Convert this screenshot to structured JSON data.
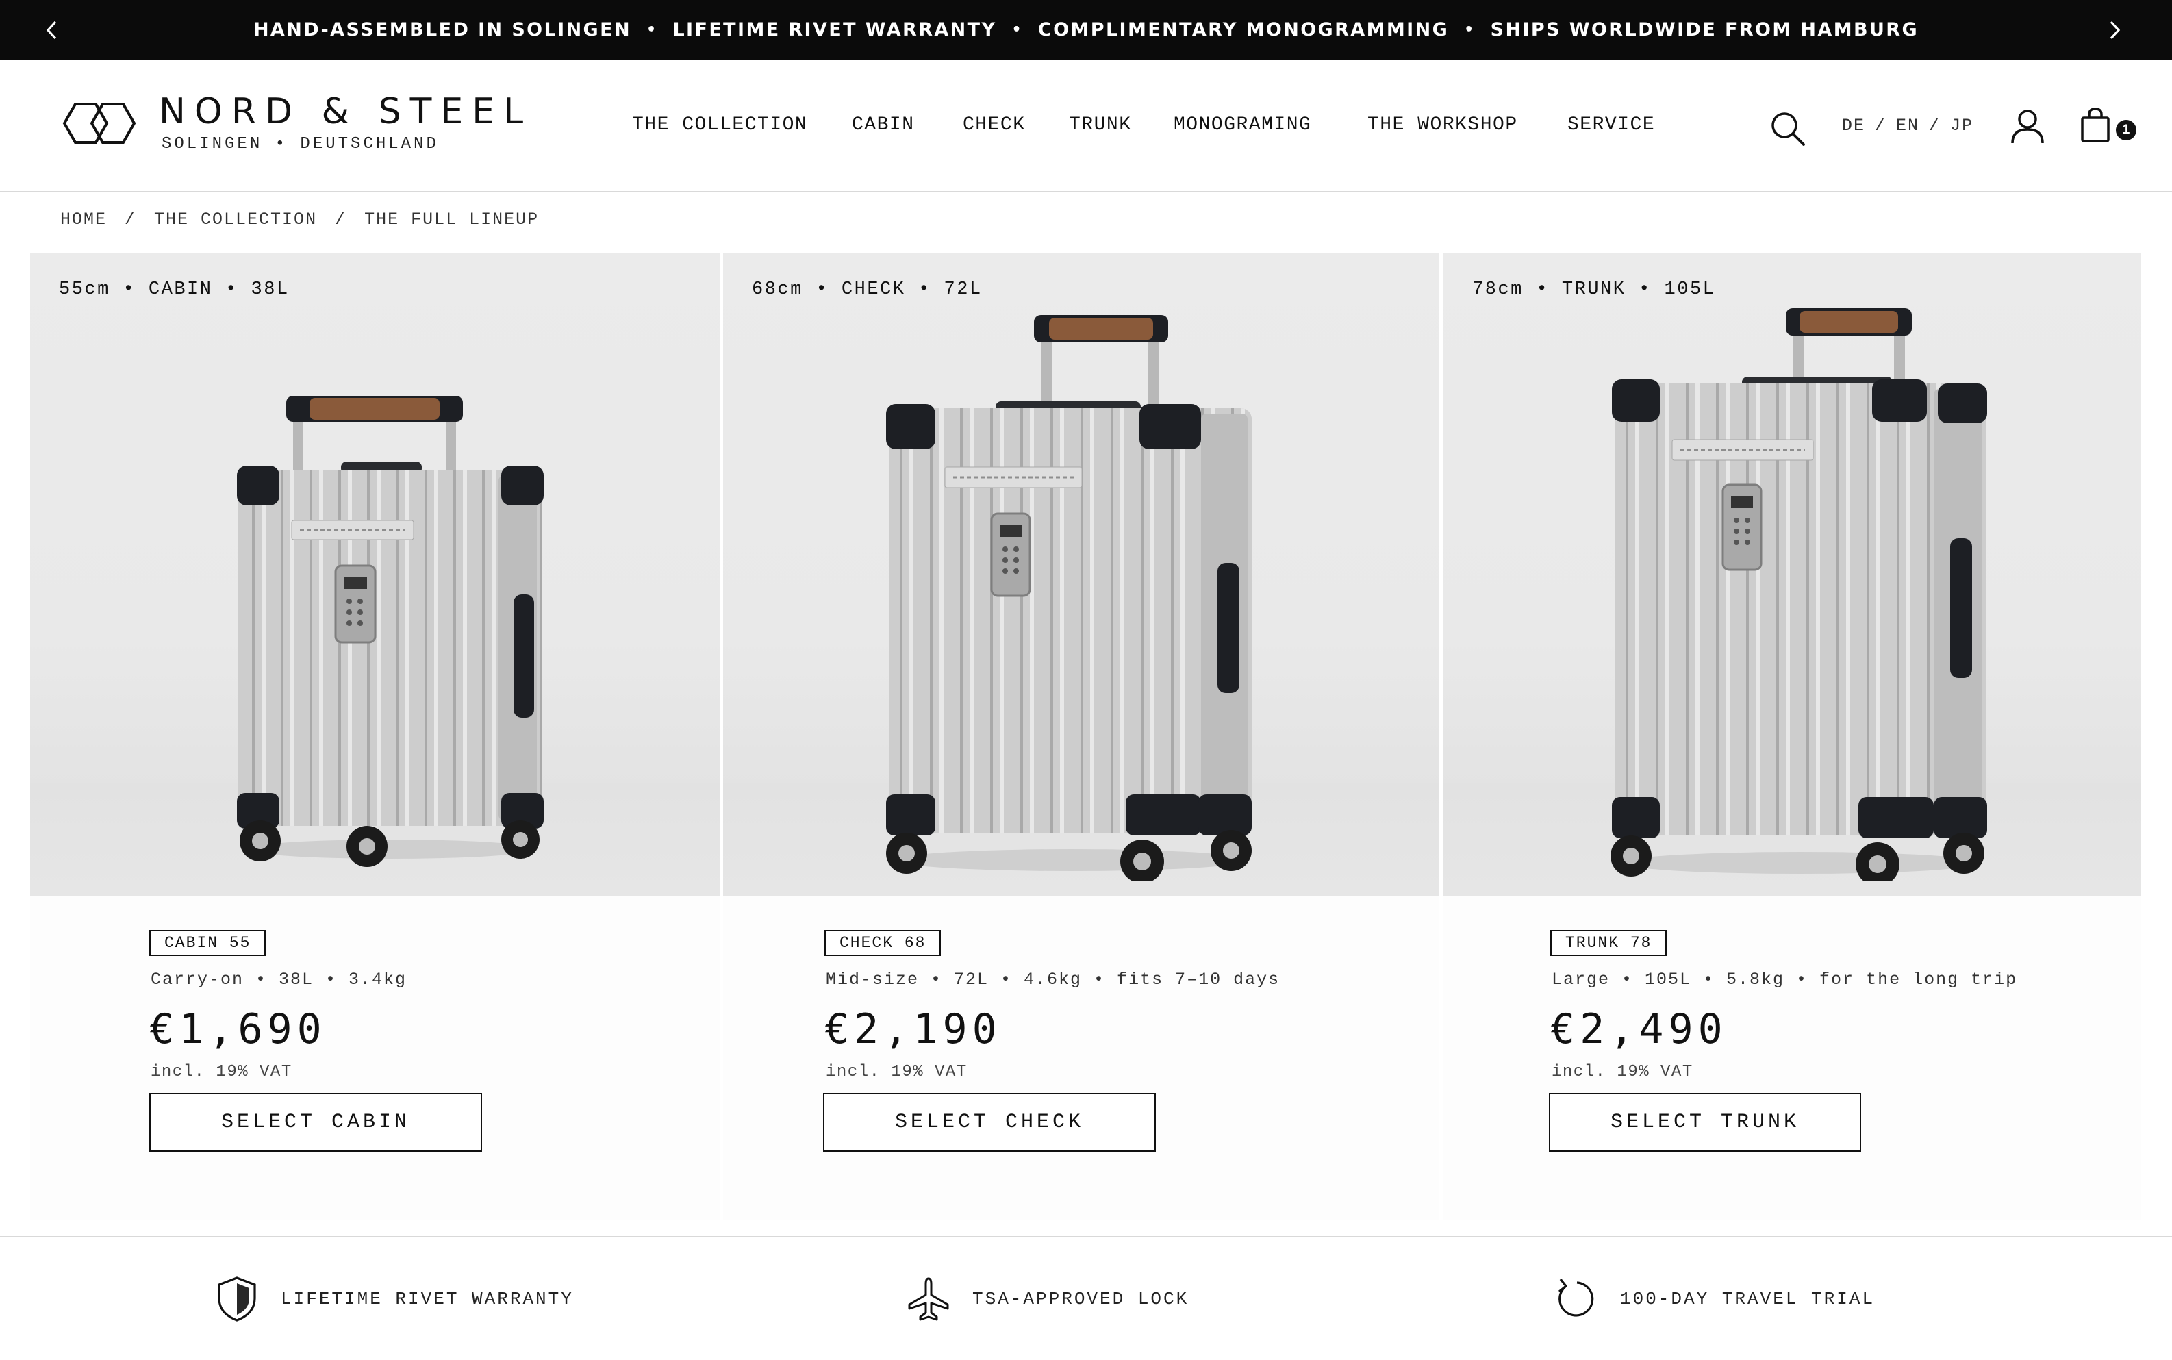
{
  "announcement": {
    "messages": [
      "HAND-ASSEMBLED IN SOLINGEN",
      "LIFETIME RIVET WARRANTY",
      "COMPLIMENTARY MONOGRAMMING",
      "SHIPS WORLDWIDE FROM HAMBURG"
    ],
    "separator": "•",
    "prev_icon": "chevron-left-icon",
    "next_icon": "chevron-right-icon"
  },
  "brand": {
    "name": "NORD & STEEL",
    "tagline": "SOLINGEN • DEUTSCHLAND"
  },
  "nav": {
    "items": [
      "THE COLLECTION",
      "CABIN",
      "CHECK",
      "TRUNK",
      "MONOGRAMING",
      "THE WORKSHOP",
      "SERVICE"
    ]
  },
  "header_tools": {
    "search_icon": "search-icon",
    "languages": [
      "DE",
      "EN",
      "JP"
    ],
    "language_separator": "/",
    "account_icon": "user-icon",
    "cart_icon": "shopping-bag-icon",
    "cart_count": "1"
  },
  "breadcrumb": {
    "items": [
      "HOME",
      "THE COLLECTION",
      "THE FULL LINEUP"
    ],
    "separator": "/"
  },
  "products": [
    {
      "spec": "55cm • CABIN • 38L",
      "badge": "CABIN 55",
      "description": "Carry-on • 38L • 3.4kg",
      "price": "€1,690",
      "vat": "incl. 19% VAT",
      "button": "SELECT CABIN"
    },
    {
      "spec": "68cm • CHECK • 72L",
      "badge": "CHECK 68",
      "description": "Mid-size • 72L • 4.6kg • fits 7–10 days",
      "price": "€2,190",
      "vat": "incl. 19% VAT",
      "button": "SELECT CHECK"
    },
    {
      "spec": "78cm • TRUNK • 105L",
      "badge": "TRUNK 78",
      "description": "Large • 105L • 5.8kg • for the long trip",
      "price": "€2,490",
      "vat": "incl. 19% VAT",
      "button": "SELECT TRUNK"
    }
  ],
  "features": [
    {
      "icon": "shield-icon",
      "label": "LIFETIME RIVET WARRANTY"
    },
    {
      "icon": "airplane-icon",
      "label": "TSA-APPROVED LOCK"
    },
    {
      "icon": "return-arrow-icon",
      "label": "100-DAY TRAVEL TRIAL"
    }
  ],
  "colors": {
    "announcement_bg": "#0b0b0b",
    "text": "#111111",
    "image_bg": "#e9e9e9",
    "aluminium": "#c9c9c9",
    "handle_leather": "#8a5a3a",
    "divider": "#d9d9d9"
  }
}
